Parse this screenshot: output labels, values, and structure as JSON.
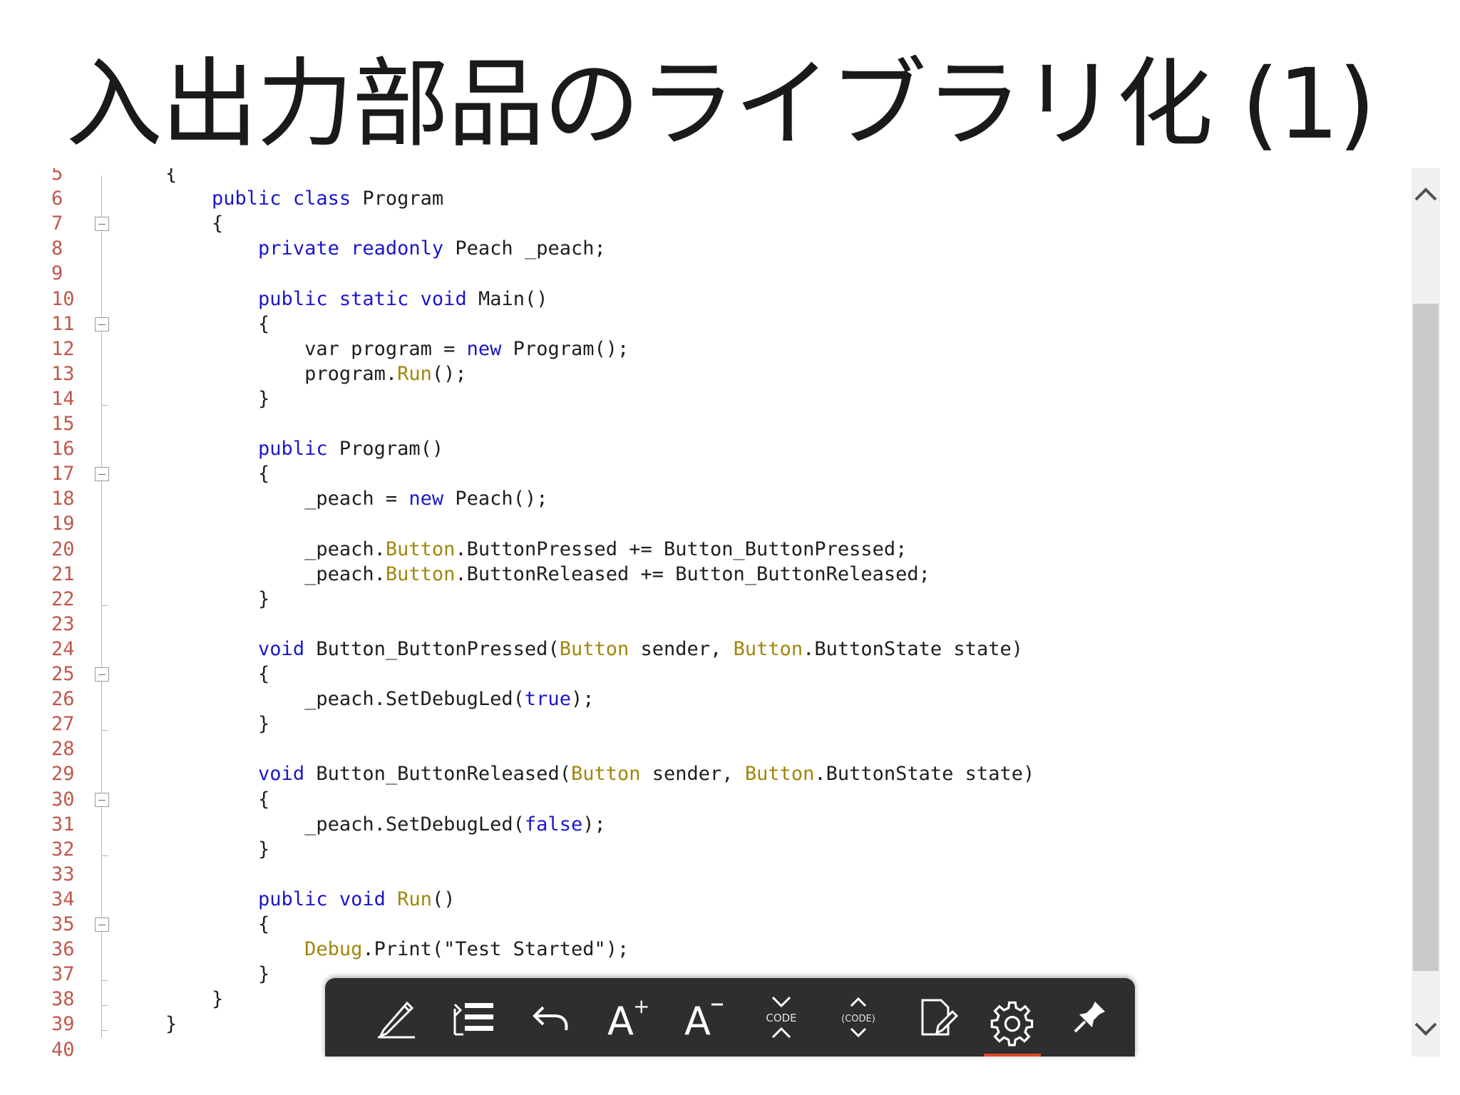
{
  "slide": {
    "title": "入出力部品のライブラリ化 (1)"
  },
  "code": {
    "partial_top_line": {
      "number": "5",
      "text": "{"
    },
    "lines": [
      {
        "n": "6",
        "tokens": [
          [
            "    ",
            ""
          ],
          [
            "public",
            "kw"
          ],
          [
            " ",
            ""
          ],
          [
            "class",
            "kw"
          ],
          [
            " Program",
            ""
          ]
        ]
      },
      {
        "n": "7",
        "tokens": [
          [
            "    {",
            ""
          ]
        ]
      },
      {
        "n": "8",
        "tokens": [
          [
            "        ",
            ""
          ],
          [
            "private",
            "kw"
          ],
          [
            " ",
            ""
          ],
          [
            "readonly",
            "kw"
          ],
          [
            " Peach _peach;",
            ""
          ]
        ]
      },
      {
        "n": "9",
        "tokens": []
      },
      {
        "n": "10",
        "tokens": [
          [
            "        ",
            ""
          ],
          [
            "public",
            "kw"
          ],
          [
            " ",
            ""
          ],
          [
            "static",
            "kw"
          ],
          [
            " ",
            ""
          ],
          [
            "void",
            "kw"
          ],
          [
            " Main()",
            ""
          ]
        ]
      },
      {
        "n": "11",
        "tokens": [
          [
            "        {",
            ""
          ]
        ]
      },
      {
        "n": "12",
        "tokens": [
          [
            "            var program = ",
            ""
          ],
          [
            "new",
            "kw"
          ],
          [
            " Program();",
            ""
          ]
        ]
      },
      {
        "n": "13",
        "tokens": [
          [
            "            program.",
            ""
          ],
          [
            "Run",
            "ty"
          ],
          [
            "();",
            ""
          ]
        ]
      },
      {
        "n": "14",
        "tokens": [
          [
            "        }",
            ""
          ]
        ]
      },
      {
        "n": "15",
        "tokens": []
      },
      {
        "n": "16",
        "tokens": [
          [
            "        ",
            ""
          ],
          [
            "public",
            "kw"
          ],
          [
            " Program()",
            ""
          ]
        ]
      },
      {
        "n": "17",
        "tokens": [
          [
            "        {",
            ""
          ]
        ]
      },
      {
        "n": "18",
        "tokens": [
          [
            "            _peach = ",
            ""
          ],
          [
            "new",
            "kw"
          ],
          [
            " Peach();",
            ""
          ]
        ]
      },
      {
        "n": "19",
        "tokens": []
      },
      {
        "n": "20",
        "tokens": [
          [
            "            _peach.",
            ""
          ],
          [
            "Button",
            "ty"
          ],
          [
            ".ButtonPressed += Button_ButtonPressed;",
            ""
          ]
        ]
      },
      {
        "n": "21",
        "tokens": [
          [
            "            _peach.",
            ""
          ],
          [
            "Button",
            "ty"
          ],
          [
            ".ButtonReleased += Button_ButtonReleased;",
            ""
          ]
        ]
      },
      {
        "n": "22",
        "tokens": [
          [
            "        }",
            ""
          ]
        ]
      },
      {
        "n": "23",
        "tokens": []
      },
      {
        "n": "24",
        "tokens": [
          [
            "        ",
            ""
          ],
          [
            "void",
            "kw"
          ],
          [
            " Button_ButtonPressed(",
            ""
          ],
          [
            "Button",
            "ty"
          ],
          [
            " sender, ",
            ""
          ],
          [
            "Button",
            "ty"
          ],
          [
            ".ButtonState state)",
            ""
          ]
        ]
      },
      {
        "n": "25",
        "tokens": [
          [
            "        {",
            ""
          ]
        ]
      },
      {
        "n": "26",
        "tokens": [
          [
            "            _peach.SetDebugLed(",
            ""
          ],
          [
            "true",
            "kw"
          ],
          [
            ");",
            ""
          ]
        ]
      },
      {
        "n": "27",
        "tokens": [
          [
            "        }",
            ""
          ]
        ]
      },
      {
        "n": "28",
        "tokens": []
      },
      {
        "n": "29",
        "tokens": [
          [
            "        ",
            ""
          ],
          [
            "void",
            "kw"
          ],
          [
            " Button_ButtonReleased(",
            ""
          ],
          [
            "Button",
            "ty"
          ],
          [
            " sender, ",
            ""
          ],
          [
            "Button",
            "ty"
          ],
          [
            ".ButtonState state)",
            ""
          ]
        ]
      },
      {
        "n": "30",
        "tokens": [
          [
            "        {",
            ""
          ]
        ]
      },
      {
        "n": "31",
        "tokens": [
          [
            "            _peach.SetDebugLed(",
            ""
          ],
          [
            "false",
            "kw"
          ],
          [
            ");",
            ""
          ]
        ]
      },
      {
        "n": "32",
        "tokens": [
          [
            "        }",
            ""
          ]
        ]
      },
      {
        "n": "33",
        "tokens": []
      },
      {
        "n": "34",
        "tokens": [
          [
            "        ",
            ""
          ],
          [
            "public",
            "kw"
          ],
          [
            " ",
            ""
          ],
          [
            "void",
            "kw"
          ],
          [
            " ",
            ""
          ],
          [
            "Run",
            "ty"
          ],
          [
            "()",
            ""
          ]
        ]
      },
      {
        "n": "35",
        "tokens": [
          [
            "        {",
            ""
          ]
        ]
      },
      {
        "n": "36",
        "tokens": [
          [
            "            ",
            ""
          ],
          [
            "Debug",
            "ty"
          ],
          [
            ".Print(\"Test Started\");",
            ""
          ]
        ]
      },
      {
        "n": "37",
        "tokens": [
          [
            "        }",
            ""
          ]
        ]
      },
      {
        "n": "38",
        "tokens": [
          [
            "    }",
            ""
          ]
        ]
      },
      {
        "n": "39",
        "tokens": [
          [
            "}",
            ""
          ]
        ]
      },
      {
        "n": "40",
        "tokens": []
      }
    ],
    "fold_lines": [
      "7",
      "11",
      "17",
      "25",
      "30",
      "35"
    ],
    "fold_end_lines": [
      "14",
      "22",
      "27",
      "32",
      "37",
      "38",
      "39"
    ]
  },
  "colors": {
    "keyword": "#1a17c9",
    "type": "#a0860a",
    "line_number": "#c0574b",
    "toolbar_bg": "#2e2e2e",
    "toolbar_active": "#e0482a"
  },
  "toolbar": {
    "items": [
      {
        "name": "pen-icon",
        "label": ""
      },
      {
        "name": "list-icon",
        "label": ""
      },
      {
        "name": "undo-icon",
        "label": ""
      },
      {
        "name": "font-increase-icon",
        "label": "A+"
      },
      {
        "name": "font-decrease-icon",
        "label": "A−"
      },
      {
        "name": "code-collapse-icon",
        "label": "CODE"
      },
      {
        "name": "code-expand-icon",
        "label": "(CODE)"
      },
      {
        "name": "page-edit-icon",
        "label": ""
      },
      {
        "name": "gear-icon",
        "label": "",
        "active": true
      },
      {
        "name": "pin-icon",
        "label": ""
      }
    ]
  }
}
